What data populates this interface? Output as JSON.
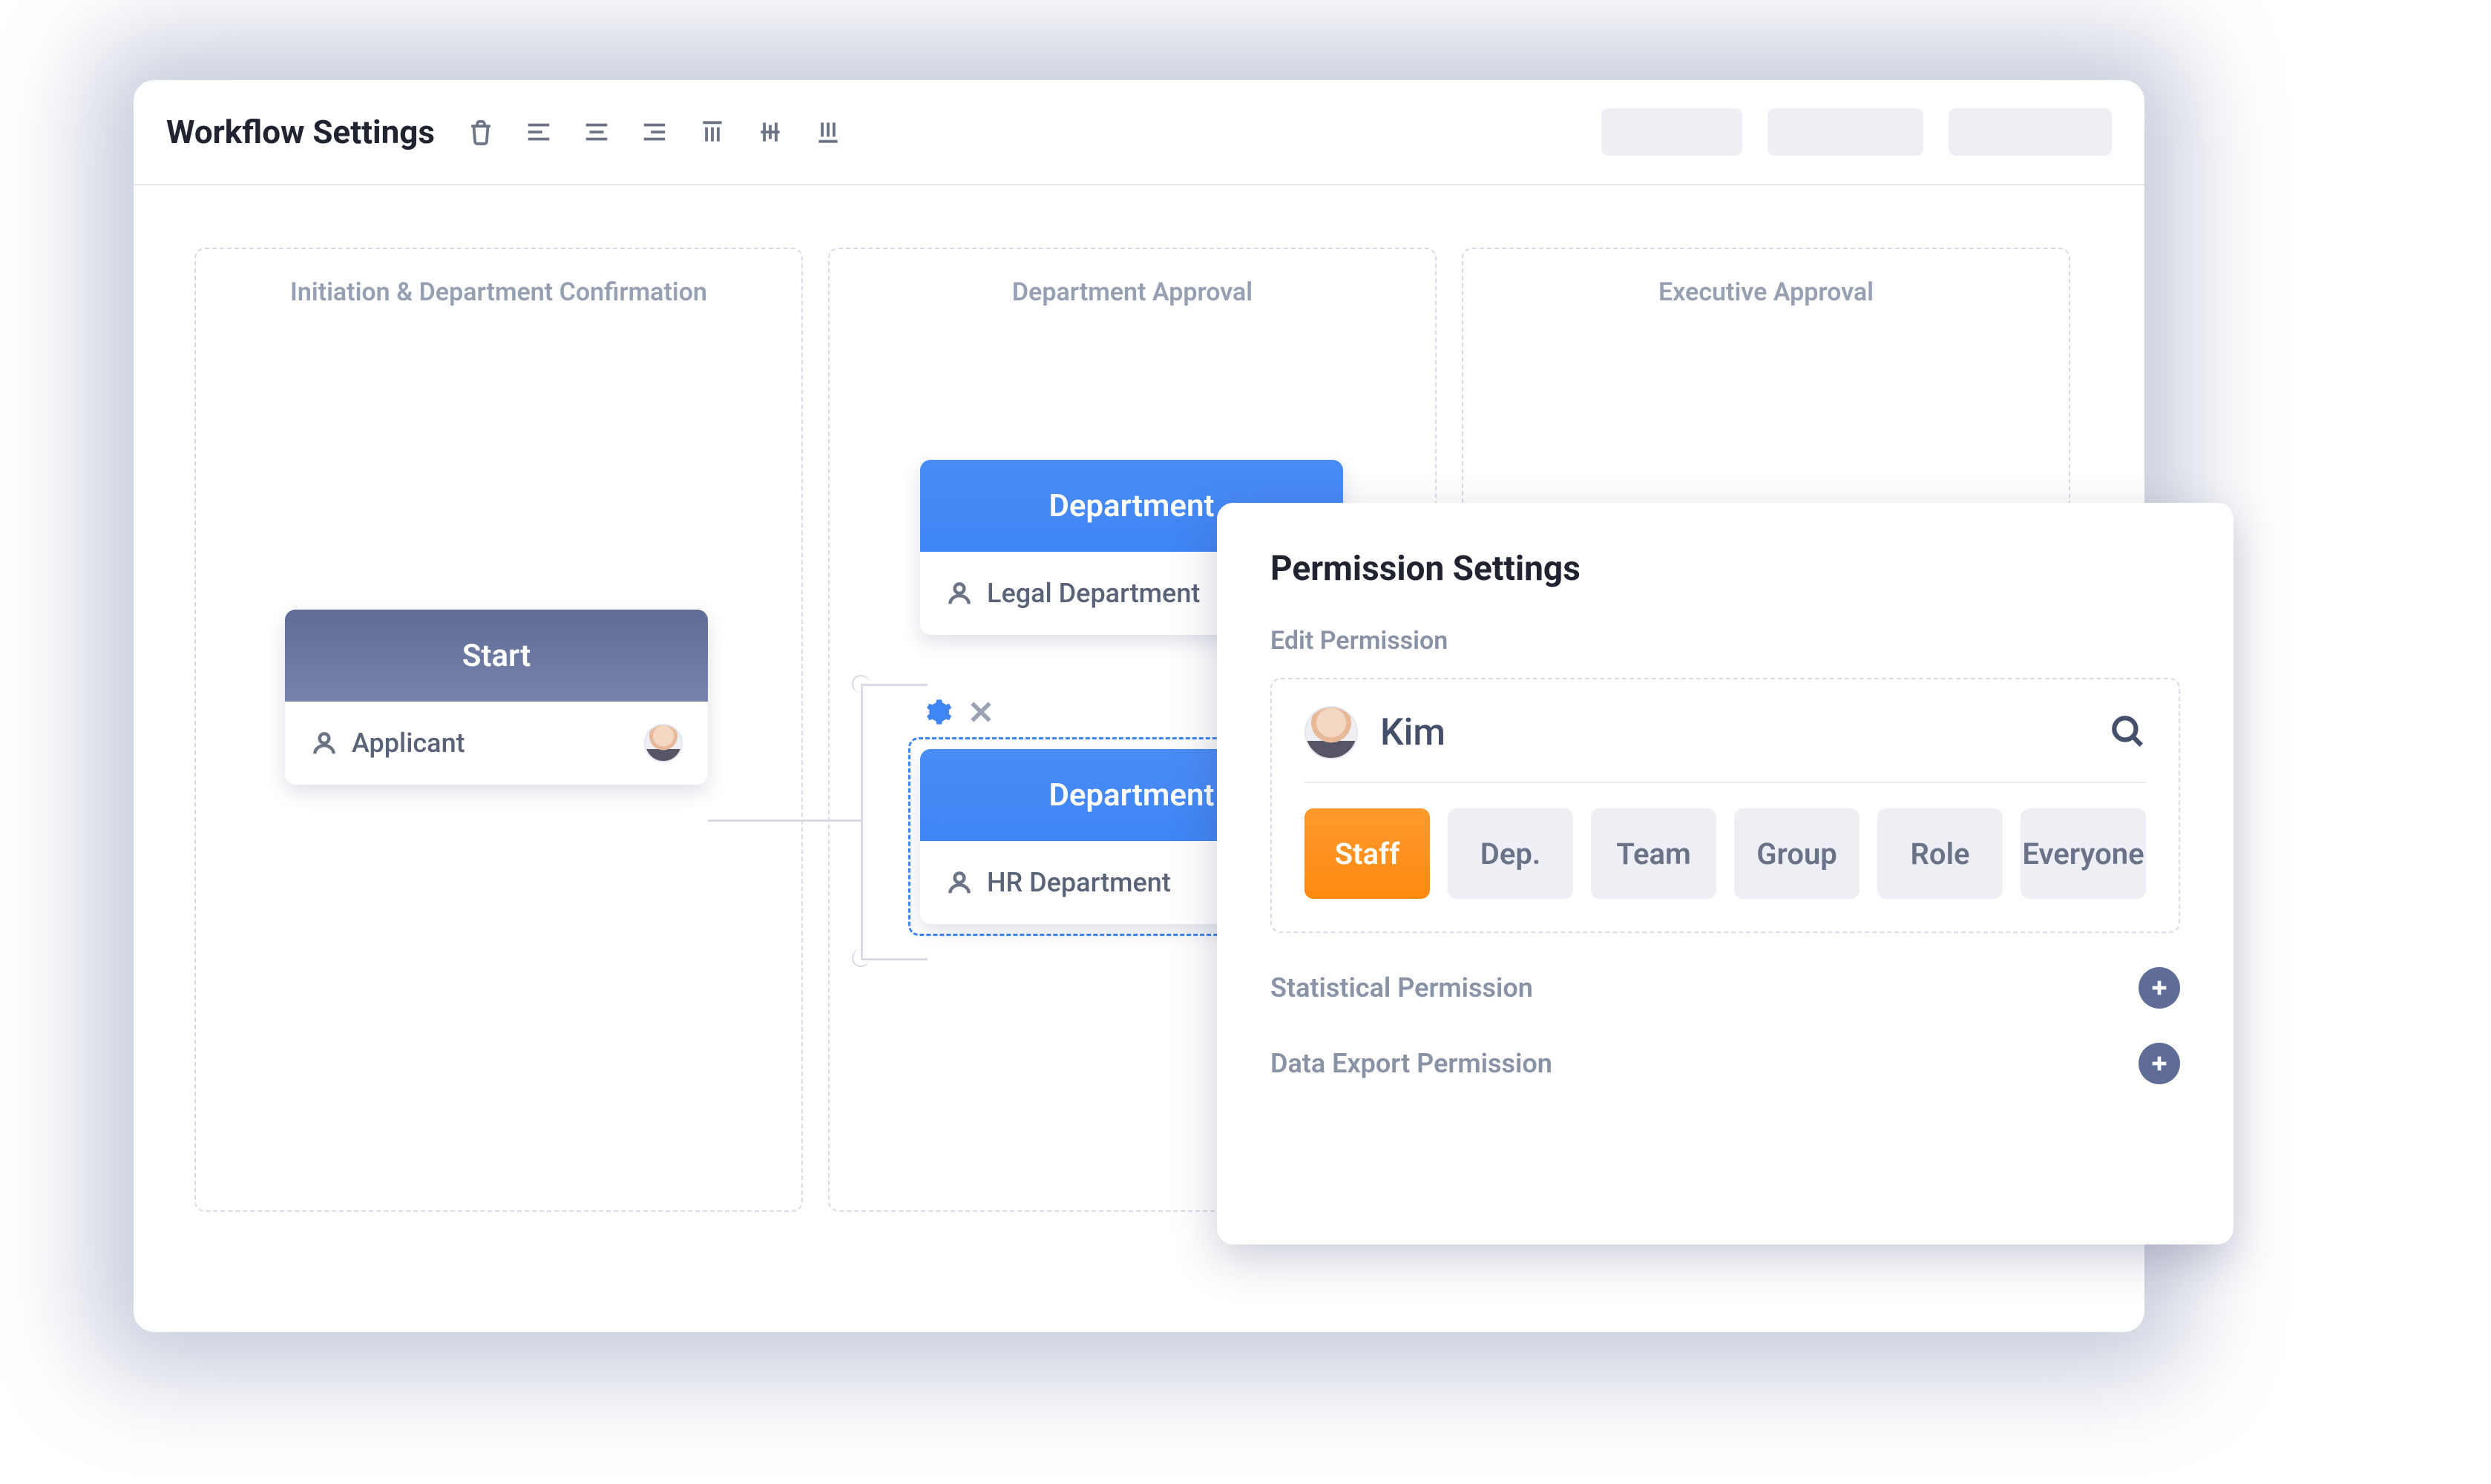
{
  "toolbar": {
    "title": "Workflow Settings"
  },
  "lanes": [
    {
      "title": "Initiation & Department Confirmation"
    },
    {
      "title": "Department Approval"
    },
    {
      "title": "Executive Approval"
    }
  ],
  "nodes": {
    "start": {
      "title": "Start",
      "actor": "Applicant"
    },
    "dept1": {
      "title": "Department",
      "actor": "Legal Department"
    },
    "dept2": {
      "title": "Department",
      "actor": "HR Department"
    }
  },
  "panel": {
    "title": "Permission Settings",
    "edit_label": "Edit Permission",
    "search_name": "Kim",
    "filters": [
      "Staff",
      "Dep.",
      "Team",
      "Group",
      "Role",
      "Everyone"
    ],
    "stat_label": "Statistical Permission",
    "export_label": "Data Export Permission"
  }
}
